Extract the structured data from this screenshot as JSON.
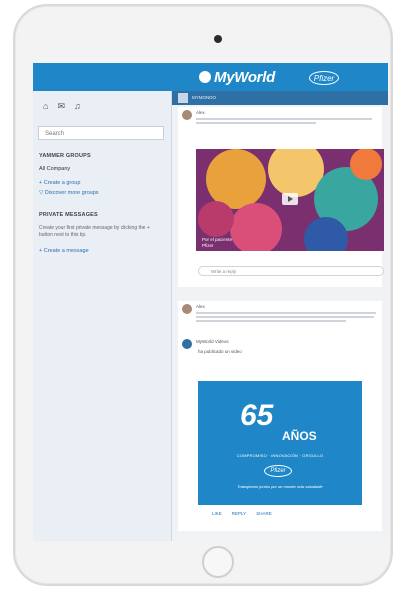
{
  "brand": {
    "name": "MyWorld",
    "partner_logo": "Pfizer"
  },
  "sidebar": {
    "icons": [
      "home-icon",
      "inbox-icon",
      "bell-icon"
    ],
    "search_placeholder": "Search",
    "groups_heading": "YAMMER GROUPS",
    "groups": [
      {
        "label": "All Company"
      }
    ],
    "create_group": "+ Create a group",
    "discover_groups": "▽ Discover more groups",
    "private_heading": "PRIVATE MESSAGES",
    "private_text": "Create your first private message by clicking the + button next to this tip.",
    "create_message": "+ Create a message"
  },
  "main": {
    "group_name": "MYMONDO",
    "announcement": {
      "author": "Alex",
      "video_caption_1": "Por el paciente",
      "video_caption_2": "Pfizer",
      "reply_placeholder": "Write a reply"
    },
    "post2": {
      "author": "Alex",
      "sub_author": "MyWorld Videos",
      "shared_line": "ha publicado un video",
      "anniversary": {
        "number": "65",
        "word": "AÑOS",
        "values": "COMPROMISO · INNOVACIÓN · ORGULLO",
        "pfizer": "Pfizer",
        "tagline": "Trabajamos juntos por un mundo más saludable"
      },
      "actions": [
        "LIKE",
        "REPLY",
        "SHARE"
      ]
    }
  }
}
